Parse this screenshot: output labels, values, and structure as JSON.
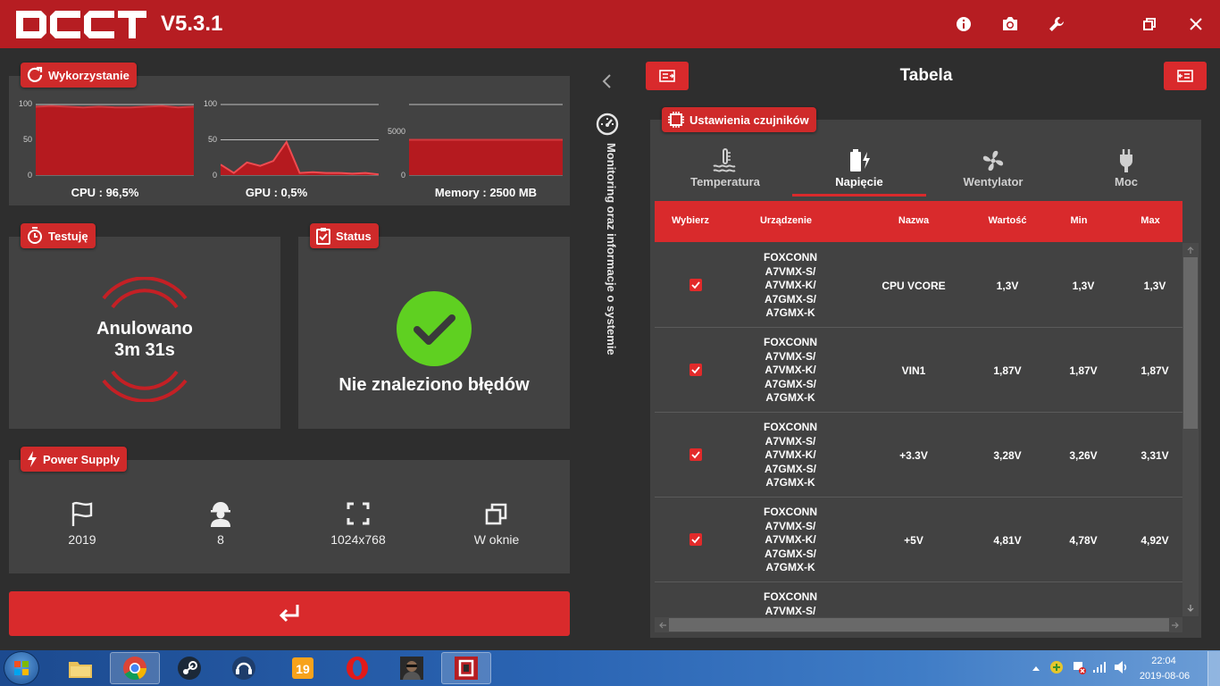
{
  "app": {
    "name": "OCCT",
    "version": "V5.3.1"
  },
  "titlebar_icons": [
    "info-icon",
    "camera-icon",
    "wrench-icon",
    "restore-icon",
    "close-icon"
  ],
  "usage": {
    "title": "Wykorzystanie",
    "cpu": {
      "label": "CPU : 96,5%",
      "ticks": [
        "100",
        "50",
        "0"
      ],
      "values": [
        97,
        98,
        97,
        96,
        97,
        96,
        96,
        97,
        98,
        96,
        97
      ]
    },
    "gpu": {
      "label": "GPU : 0,5%",
      "ticks": [
        "100",
        "50",
        "0"
      ],
      "values": [
        15,
        3,
        18,
        13,
        20,
        47,
        3,
        4,
        3,
        3,
        2,
        3,
        1
      ]
    },
    "memory": {
      "label": "Memory : 2500 MB",
      "ticks": [
        "5000",
        "0"
      ],
      "ymax": 5000,
      "values": [
        2500,
        2500,
        2500,
        2500,
        2500
      ]
    }
  },
  "testing": {
    "title": "Testuję",
    "line1": "Anulowano",
    "line2": "3m 31s"
  },
  "status": {
    "title": "Status",
    "message": "Nie znaleziono błędów"
  },
  "power_supply": {
    "title": "Power Supply",
    "items": [
      {
        "icon": "flag-icon",
        "value": "2019"
      },
      {
        "icon": "worker-icon",
        "value": "8"
      },
      {
        "icon": "fullscreen-icon",
        "value": "1024x768"
      },
      {
        "icon": "windowed-icon",
        "value": "W oknie"
      }
    ]
  },
  "sidebar_label": "Monitoring oraz informacje o systemie",
  "right": {
    "title": "Tabela",
    "sensor_settings": "Ustawienia czujników",
    "tabs": [
      {
        "label": "Temperatura",
        "icon": "temperature-icon"
      },
      {
        "label": "Napięcie",
        "icon": "battery-voltage-icon",
        "active": true
      },
      {
        "label": "Wentylator",
        "icon": "fan-icon"
      },
      {
        "label": "Moc",
        "icon": "plug-icon"
      }
    ],
    "columns": [
      "Wybierz",
      "Urządzenie",
      "Nazwa",
      "Wartość",
      "Min",
      "Max"
    ],
    "rows": [
      {
        "device": [
          "FOXCONN",
          "A7VMX-S/",
          "A7VMX-K/",
          "A7GMX-S/",
          "A7GMX-K"
        ],
        "name": "CPU VCORE",
        "value": "1,3V",
        "min": "1,3V",
        "max": "1,3V"
      },
      {
        "device": [
          "FOXCONN",
          "A7VMX-S/",
          "A7VMX-K/",
          "A7GMX-S/",
          "A7GMX-K"
        ],
        "name": "VIN1",
        "value": "1,87V",
        "min": "1,87V",
        "max": "1,87V"
      },
      {
        "device": [
          "FOXCONN",
          "A7VMX-S/",
          "A7VMX-K/",
          "A7GMX-S/",
          "A7GMX-K"
        ],
        "name": "+3.3V",
        "value": "3,28V",
        "min": "3,26V",
        "max": "3,31V"
      },
      {
        "device": [
          "FOXCONN",
          "A7VMX-S/",
          "A7VMX-K/",
          "A7GMX-S/",
          "A7GMX-K"
        ],
        "name": "+5V",
        "value": "4,81V",
        "min": "4,78V",
        "max": "4,92V"
      },
      {
        "device": [
          "FOXCONN",
          "A7VMX-S/"
        ],
        "name": "",
        "value": "",
        "min": "",
        "max": ""
      }
    ]
  },
  "taskbar": {
    "apps": [
      "explorer-icon",
      "chrome-icon",
      "steam-icon",
      "teamspeak-icon",
      "game-19-icon",
      "opera-icon",
      "game-avatar-icon",
      "occt-icon"
    ],
    "time": "22:04",
    "date": "2019-08-06"
  }
}
